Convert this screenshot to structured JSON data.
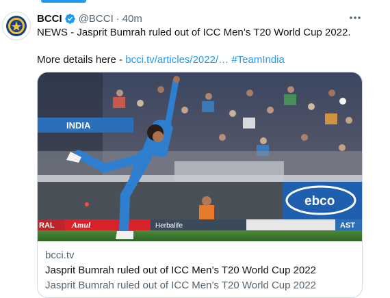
{
  "tweet": {
    "author_name": "BCCI",
    "verified": true,
    "handle": "@BCCI",
    "separator": "·",
    "time": "40m",
    "text_line1": "NEWS - Jasprit Bumrah ruled out of ICC Men’s T20 World Cup 2022.",
    "text_line2_prefix": "More details here - ",
    "link_text": "bcci.tv/articles/2022/…",
    "hashtag": "#TeamIndia"
  },
  "card": {
    "domain": "bcci.tv",
    "title": "Jasprit Bumrah ruled out of ICC Men’s T20 World Cup 2022",
    "description": "Jasprit Bumrah ruled out of ICC Men’s T20 World Cup 2022",
    "image_text": {
      "board_india": "INDIA",
      "banner_ebco": "ebco",
      "ad_amul": "Amul",
      "ad_herbal": "Herbalife",
      "ad_ast": "AST",
      "ad_ral": "RAL"
    }
  },
  "colors": {
    "accent": "#1d9bf0",
    "text_primary": "#0f1419",
    "text_secondary": "#536471",
    "jersey": "#2f7fd0",
    "pitch": "#3e7b2e"
  },
  "icons": [
    "bcci-logo-avatar",
    "verified-badge-icon",
    "more-options-icon"
  ]
}
